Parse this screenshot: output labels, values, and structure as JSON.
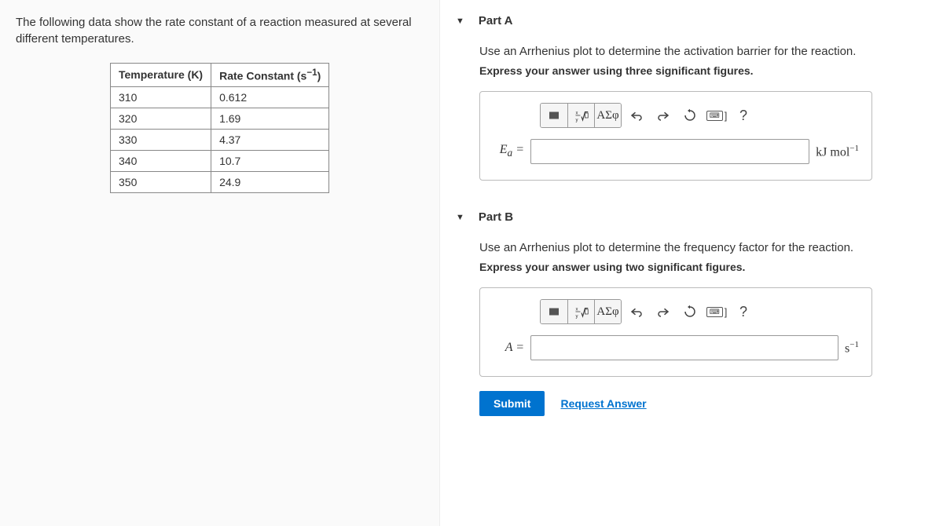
{
  "intro": "The following data show the rate constant of a reaction measured at several different temperatures.",
  "table": {
    "headers": {
      "col1": "Temperature (K)",
      "col2_prefix": "Rate Constant ",
      "col2_unit_base": "(s",
      "col2_unit_exp": "−1",
      "col2_unit_suffix": ")"
    },
    "rows": [
      {
        "t": "310",
        "k": "0.612"
      },
      {
        "t": "320",
        "k": "1.69"
      },
      {
        "t": "330",
        "k": "4.37"
      },
      {
        "t": "340",
        "k": "10.7"
      },
      {
        "t": "350",
        "k": "24.9"
      }
    ]
  },
  "partA": {
    "title": "Part A",
    "instruction": "Use an Arrhenius plot to determine the activation barrier for the reaction.",
    "bold": "Express your answer using three significant figures.",
    "var_html": "E<sub>a</sub> =",
    "unit_html": "kJ mol<sup>−1</sup>"
  },
  "partB": {
    "title": "Part B",
    "instruction": "Use an Arrhenius plot to determine the frequency factor for the reaction.",
    "bold": "Express your answer using two significant figures.",
    "var": "A =",
    "unit_html": "s<sup>−1</sup>",
    "submit": "Submit",
    "request": "Request Answer"
  },
  "toolbar": {
    "greek": "ΑΣφ",
    "help": "?",
    "bracket": "]"
  }
}
